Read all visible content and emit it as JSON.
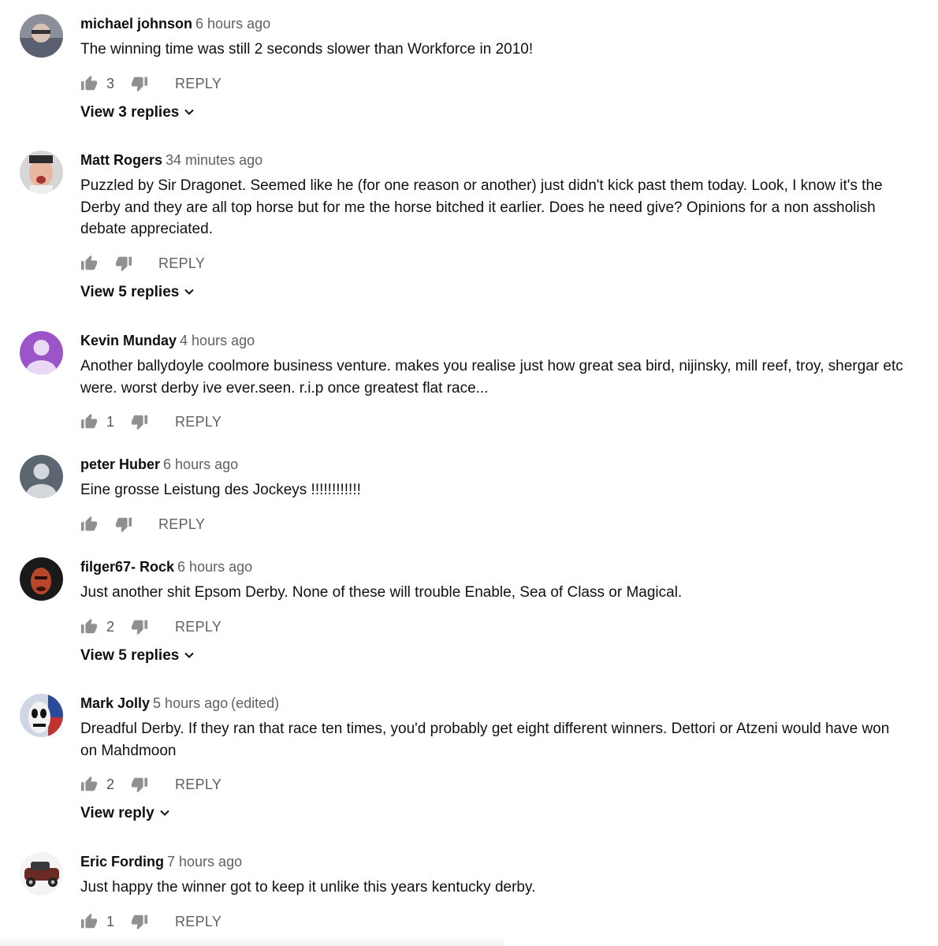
{
  "comments": [
    {
      "author": "michael johnson",
      "time": "6 hours ago",
      "edited": "",
      "text": "The winning time was still 2 seconds slower than Workforce in 2010!",
      "likes": "3",
      "reply_label": "REPLY",
      "view_replies": "View 3 replies",
      "avatar_icon": "user-photo-avatar"
    },
    {
      "author": "Matt Rogers",
      "time": "34 minutes ago",
      "edited": "",
      "text": "Puzzled by Sir Dragonet. Seemed like he (for one reason or another) just didn't kick past them today. Look, I know it's the Derby and they are all top horse but for me the horse bitched it earlier. Does he need give? Opinions for a non assholish debate appreciated.",
      "likes": "",
      "reply_label": "REPLY",
      "view_replies": "View 5 replies",
      "avatar_icon": "user-photo-avatar"
    },
    {
      "author": "Kevin Munday",
      "time": "4 hours ago",
      "edited": "",
      "text": "Another ballydoyle coolmore business venture. makes you realise just how great sea bird, nijinsky, mill reef,  troy, shergar etc were. worst derby ive ever.seen. r.i.p once greatest flat race...",
      "likes": "1",
      "reply_label": "REPLY",
      "view_replies": "",
      "avatar_icon": "default-avatar-purple"
    },
    {
      "author": "peter Huber",
      "time": "6 hours ago",
      "edited": "",
      "text": "Eine grosse Leistung des Jockeys !!!!!!!!!!!!",
      "likes": "",
      "reply_label": "REPLY",
      "view_replies": "",
      "avatar_icon": "default-avatar-grey"
    },
    {
      "author": "filger67- Rock",
      "time": "6 hours ago",
      "edited": "",
      "text": "Just another shit Epsom Derby. None of these will trouble Enable, Sea of Class or Magical.",
      "likes": "2",
      "reply_label": "REPLY",
      "view_replies": "View 5 replies",
      "avatar_icon": "user-photo-avatar"
    },
    {
      "author": "Mark Jolly",
      "time": "5 hours ago",
      "edited": "(edited)",
      "text": "Dreadful Derby. If they ran that race ten times, you'd probably get eight different winners. Dettori or Atzeni would have won on Mahdmoon",
      "likes": "2",
      "reply_label": "REPLY",
      "view_replies": "View reply",
      "avatar_icon": "user-photo-avatar"
    },
    {
      "author": "Eric Fording",
      "time": "7 hours ago",
      "edited": "",
      "text": "Just happy the winner got to keep it unlike this years kentucky derby.",
      "likes": "1",
      "reply_label": "REPLY",
      "view_replies": "",
      "avatar_icon": "car-photo-avatar"
    }
  ],
  "colors": {
    "author": "#0f0f0f",
    "meta": "#606060",
    "icon": "#909090",
    "default_avatar_purple": "#9c54c9",
    "default_avatar_grey": "#5c6670"
  }
}
